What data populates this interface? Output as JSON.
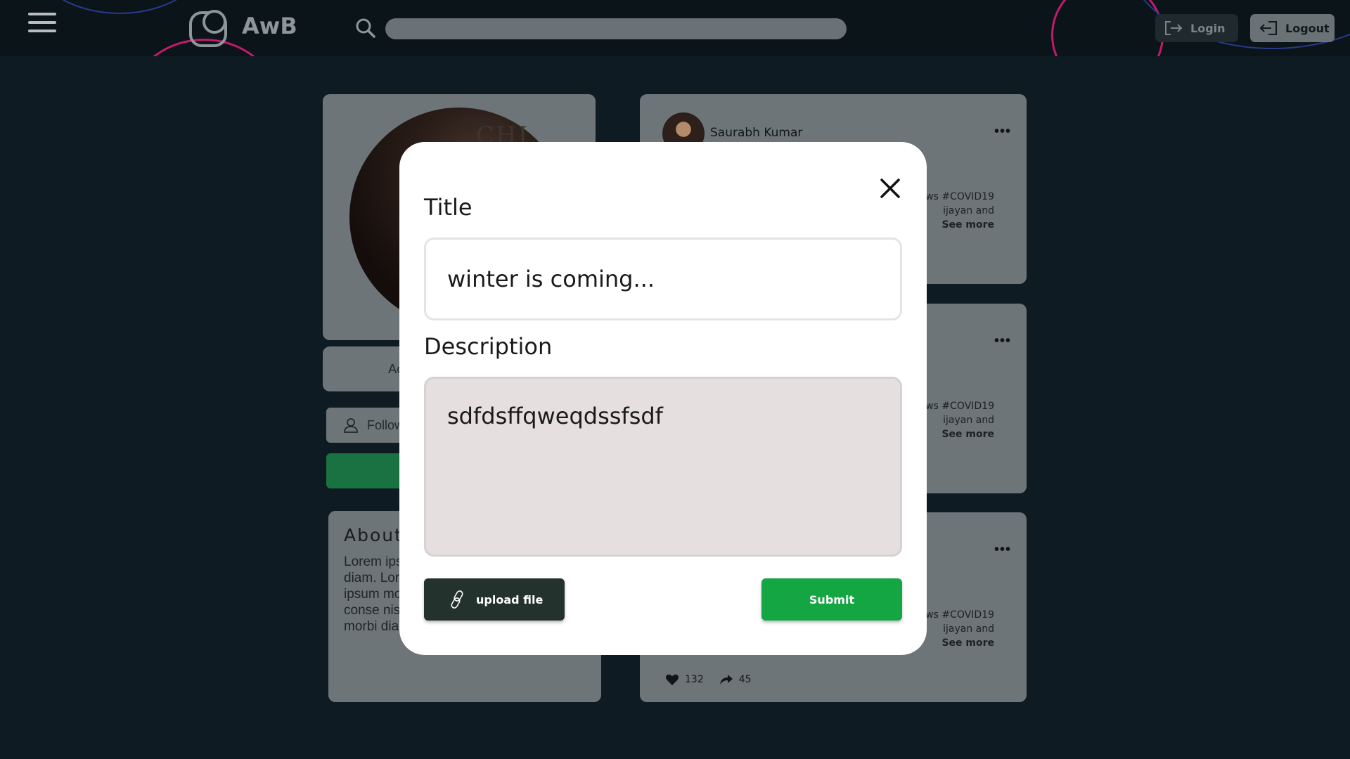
{
  "app": {
    "name": "AwB"
  },
  "colors": {
    "accent_green": "#14a643",
    "upload_dark": "#24322d",
    "topbar_bg": "#0a1419",
    "page_bg": "#0f1b22"
  },
  "header": {
    "login_label": "Login",
    "logout_label": "Logout",
    "search_placeholder": ""
  },
  "profile": {
    "name_partial": "Ac",
    "follow_label": "Follow",
    "photo_letters": "CHI"
  },
  "about": {
    "title": "About",
    "text": "Lorem ips adipiscing diam. Lore consectet ipsum mo amet, conse nisl ipsum morbi diam."
  },
  "posts": [
    {
      "author": "Saurabh Kumar",
      "tags_line1": "ws #COVID19",
      "tags_line2": "ijayan and",
      "see_more": "See more"
    },
    {
      "author": "",
      "tags_line1": "ws #COVID19",
      "tags_line2": "ijayan and",
      "see_more": "See more"
    },
    {
      "author": "",
      "tags_line1": "ws #COVID19",
      "tags_line2": "ijayan and",
      "see_more": "See more",
      "likes": "132",
      "shares": "45"
    }
  ],
  "modal": {
    "title_label": "Title",
    "title_value": "winter is coming...",
    "description_label": "Description",
    "description_value": "sdfdsffqweqdssfsdf",
    "upload_label": "upload file",
    "submit_label": "Submit"
  }
}
